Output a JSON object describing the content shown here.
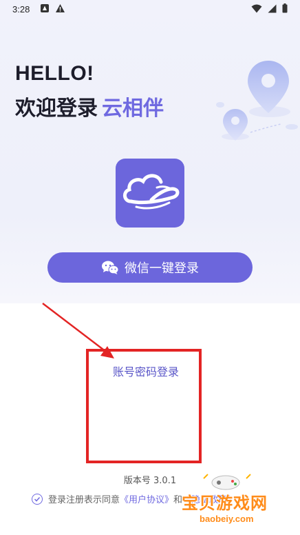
{
  "status_bar": {
    "time": "3:28"
  },
  "header": {
    "greeting": "HELLO!",
    "welcome": "欢迎登录",
    "brand": "云相伴"
  },
  "wechat_login": {
    "label": "微信一键登录"
  },
  "account_login": {
    "label": "账号密码登录"
  },
  "footer": {
    "version": "版本号 3.0.1",
    "agree_prefix": "登录注册表示同意",
    "user_agreement": "《用户协议》",
    "and": "和",
    "privacy": "《隐私政策》"
  },
  "watermark": {
    "title": "宝贝游戏网",
    "url": "baobeiy.com"
  },
  "colors": {
    "accent": "#6c66dc",
    "annotation": "#e32424",
    "watermark": "#ff8c1a"
  }
}
